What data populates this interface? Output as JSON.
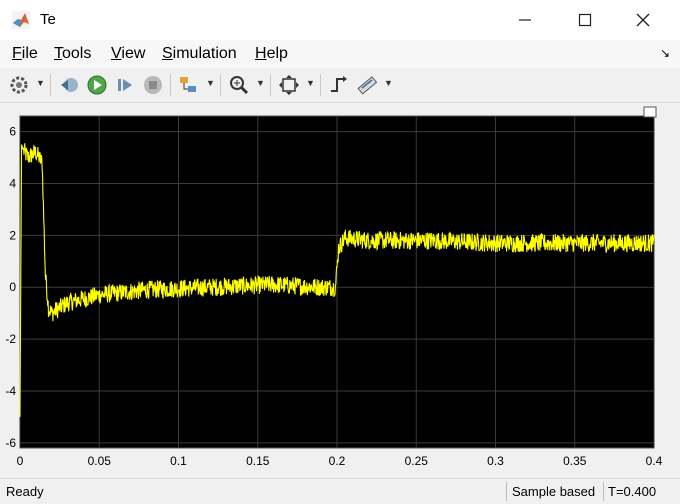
{
  "window": {
    "title": "Te"
  },
  "menu": [
    {
      "label": "File",
      "accel": "F",
      "rest": "ile"
    },
    {
      "label": "Tools",
      "accel": "T",
      "rest": "ools"
    },
    {
      "label": "View",
      "accel": "V",
      "rest": "iew"
    },
    {
      "label": "Simulation",
      "accel": "S",
      "rest": "imulation"
    },
    {
      "label": "Help",
      "accel": "H",
      "rest": "elp"
    }
  ],
  "toolbar": {
    "icons": [
      "gear-icon",
      "step-back-icon",
      "run-icon",
      "step-forward-icon",
      "stop-icon",
      "signal-select-icon",
      "zoom-icon",
      "fit-to-view-icon",
      "triggers-icon",
      "measurements-icon"
    ]
  },
  "status": {
    "left": "Ready",
    "sample": "Sample based",
    "time": "T=0.400"
  },
  "colors": {
    "plot_bg": "#000000",
    "grid": "#3b3b3b",
    "signal": "#ffff00",
    "axes_text": "#000000"
  },
  "chart_data": {
    "type": "line",
    "xlim": [
      0,
      0.4
    ],
    "ylim": [
      -6.2,
      6.6
    ],
    "xticks": [
      "0",
      "0.05",
      "0.1",
      "0.15",
      "0.2",
      "0.25",
      "0.3",
      "0.35",
      "0.4"
    ],
    "xtick_values": [
      0,
      0.05,
      0.1,
      0.15,
      0.2,
      0.25,
      0.3,
      0.35,
      0.4
    ],
    "yticks": [
      "6",
      "4",
      "2",
      "0",
      "-2",
      "-4",
      "-6"
    ],
    "ytick_values": [
      6,
      4,
      2,
      0,
      -2,
      -4,
      -6
    ],
    "grid": true,
    "series": [
      {
        "color": "#ffff00",
        "x": [
          0,
          0.0005,
          0.001,
          0.002,
          0.005,
          0.01,
          0.014,
          0.016,
          0.018,
          0.02,
          0.03,
          0.05,
          0.08,
          0.12,
          0.16,
          0.19,
          0.199,
          0.201,
          0.205,
          0.22,
          0.26,
          0.3,
          0.35,
          0.4
        ],
        "y": [
          -5.0,
          0.3,
          5.5,
          5.3,
          5.0,
          5.2,
          4.8,
          0.5,
          -0.8,
          -1.0,
          -0.6,
          -0.3,
          -0.1,
          0.0,
          0.1,
          0.0,
          0.0,
          1.5,
          1.9,
          1.8,
          1.8,
          1.7,
          1.7,
          1.7
        ],
        "noise_band": 0.35
      }
    ]
  }
}
